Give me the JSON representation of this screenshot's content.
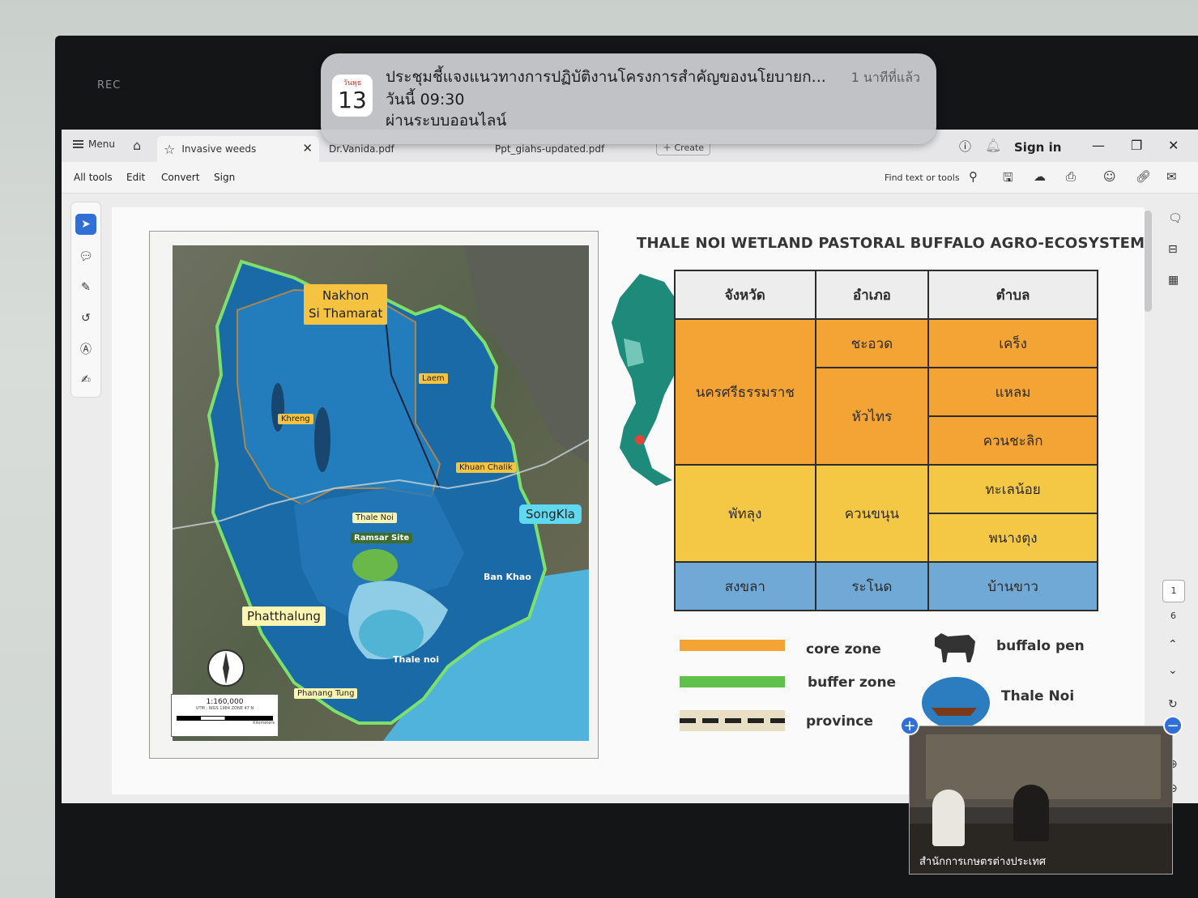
{
  "recording": {
    "label": "REC"
  },
  "notification": {
    "cal_day": "วันพุธ",
    "cal_num": "13",
    "title": "ประชุมชี้แจงแนวทางการปฏิบัติงานโครงการสำคัญของนโยบายก...",
    "time_ago": "1 นาทีที่แล้ว",
    "line2": "วันนี้ 09:30",
    "line3": "ผ่านระบบออนไลน์"
  },
  "tabbar": {
    "menu": "Menu",
    "tabs": [
      {
        "label": "Invasive weeds"
      },
      {
        "label": "Dr.Vanida.pdf"
      },
      {
        "label": "Ppt_giahs-updated.pdf"
      }
    ],
    "create": "Create",
    "sign_in": "Sign in"
  },
  "toolbar": {
    "items": [
      "All tools",
      "Edit",
      "Convert",
      "Sign"
    ],
    "find": "Find text or tools"
  },
  "pager": {
    "current": "1",
    "total": "6"
  },
  "map": {
    "labels": {
      "nakhon": "Nakhon\nSi Thamarat",
      "laem": "Laem",
      "khreng": "Khreng",
      "khuan_chalik": "Khuan Chalik",
      "songkla": "SongKla",
      "thale_noi_tag": "Thale Noi",
      "ramsar": "Ramsar Site",
      "ban_khao": "Ban Khao",
      "phatthalung": "Phatthalung",
      "thale_noi_lower": "Thale noi",
      "phanang_tung": "Phanang Tung"
    },
    "scale": {
      "ratio": "1:160,000",
      "sub": "UTM : WGS 1984 ZONE 47 N",
      "units": "Kilometers"
    }
  },
  "slide": {
    "title": "THALE NOI WETLAND PASTORAL BUFFALO AGRO-ECOSYSTEM",
    "headers": [
      "จังหวัด",
      "อำเภอ",
      "ตำบล"
    ],
    "provinces": [
      "นครศรีธรรมราช",
      "พัทลุง",
      "สงขลา"
    ],
    "districts": [
      "ชะอวด",
      "หัวไทร",
      "ควนขนุน",
      "ระโนด"
    ],
    "subdistricts": [
      "เคร็ง",
      "แหลม",
      "ควนชะลิก",
      "ทะเลน้อย",
      "พนางตุง",
      "บ้านขาว"
    ],
    "legend": {
      "core": "core zone",
      "buffer": "buffer zone",
      "province": "province",
      "buffalo": "buffalo pen",
      "thale": "Thale Noi"
    },
    "colors": {
      "core": "#f4a434",
      "buffer": "#5fc04a",
      "lower": "#70a8d6"
    }
  },
  "video": {
    "label": "สำนักการเกษตรต่างประเทศ"
  }
}
